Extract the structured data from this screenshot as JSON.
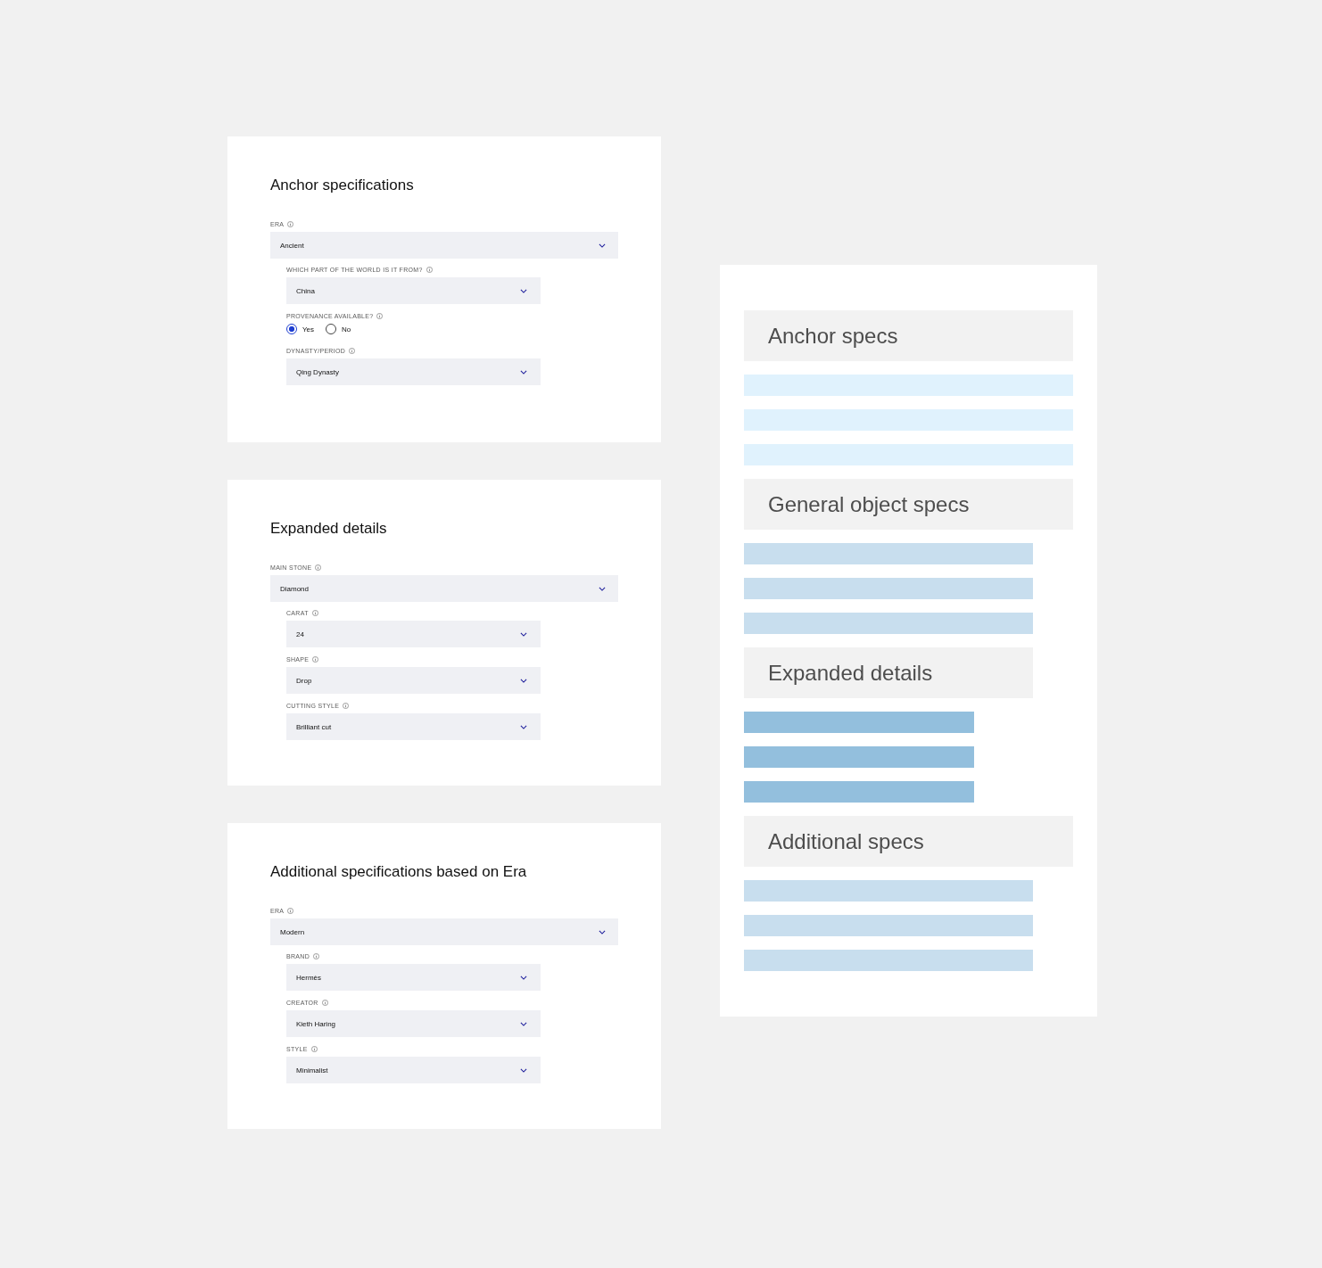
{
  "cards": [
    {
      "title": "Anchor specifications",
      "fields": [
        {
          "kind": "select",
          "label": "ERA",
          "value": "Ancient",
          "children": [
            {
              "kind": "select",
              "label": "WHICH PART OF THE WORLD IS IT FROM?",
              "value": "China"
            },
            {
              "kind": "radio",
              "label": "PROVENANCE AVAILABLE?",
              "options": [
                {
                  "label": "Yes",
                  "selected": true
                },
                {
                  "label": "No",
                  "selected": false
                }
              ]
            },
            {
              "kind": "select",
              "label": "DYNASTY/PERIOD",
              "value": "Qing Dynasty"
            }
          ]
        }
      ]
    },
    {
      "title": "Expanded details",
      "fields": [
        {
          "kind": "select",
          "label": "MAIN STONE",
          "value": "Diamond",
          "children": [
            {
              "kind": "select",
              "label": "CARAT",
              "value": "24"
            },
            {
              "kind": "select",
              "label": "SHAPE",
              "value": "Drop"
            },
            {
              "kind": "select",
              "label": "CUTTING STYLE",
              "value": "Brilliant cut"
            }
          ]
        }
      ]
    },
    {
      "title": "Additional specifications based on Era",
      "fields": [
        {
          "kind": "select",
          "label": "ERA",
          "value": "Modern",
          "children": [
            {
              "kind": "select",
              "label": "BRAND",
              "value": "Hermès"
            },
            {
              "kind": "select",
              "label": "CREATOR",
              "value": "Kieth Haring"
            },
            {
              "kind": "select",
              "label": "STYLE",
              "value": "Minimalist"
            }
          ]
        }
      ]
    }
  ],
  "outline": {
    "sections": [
      {
        "title": "Anchor specs",
        "bars": [
          {
            "color": "#e0f2fd"
          },
          {
            "color": "#e0f2fd"
          },
          {
            "color": "#e0f2fd"
          }
        ]
      },
      {
        "title": "General object specs",
        "bars": [
          {
            "color": "#c8deee"
          },
          {
            "color": "#c8deee"
          },
          {
            "color": "#c8deee"
          }
        ]
      },
      {
        "title": "Expanded details",
        "bars": [
          {
            "color": "#93bfdd"
          },
          {
            "color": "#93bfdd"
          },
          {
            "color": "#93bfdd"
          }
        ]
      },
      {
        "title": "Additional specs",
        "bars": [
          {
            "color": "#c8deee"
          },
          {
            "color": "#c8deee"
          },
          {
            "color": "#c8deee"
          }
        ]
      }
    ]
  }
}
